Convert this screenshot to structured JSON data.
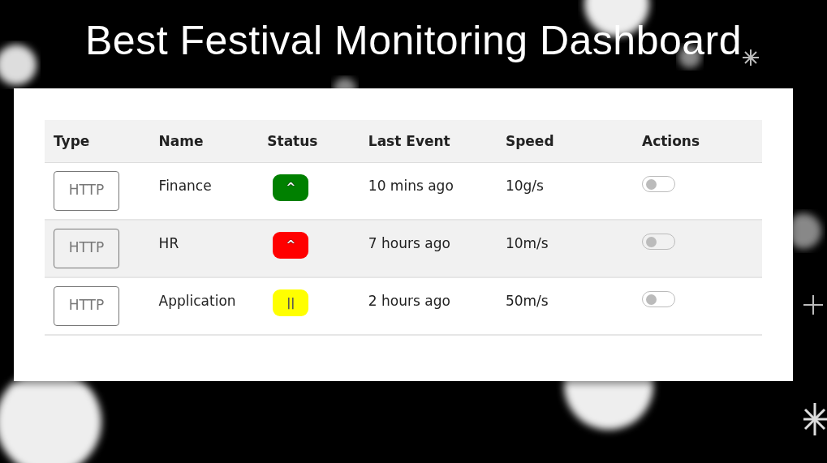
{
  "page": {
    "title": "Best Festival Monitoring Dashboard"
  },
  "table": {
    "columns": [
      "Type",
      "Name",
      "Status",
      "Last Event",
      "Speed",
      "Actions"
    ],
    "rows": [
      {
        "type": "HTTP",
        "name": "Finance",
        "status": "^",
        "color": "#008000",
        "last_event": "10 mins ago",
        "speed": "10g/s",
        "on": false,
        "highlighted": false
      },
      {
        "type": "HTTP",
        "name": "HR",
        "status": "^",
        "color": "#ff0000",
        "last_event": "7 hours ago",
        "speed": "10m/s",
        "on": false,
        "highlighted": true
      },
      {
        "type": "HTTP",
        "name": "Application",
        "status": "||",
        "color": "#ffff00",
        "last_event": "2 hours ago",
        "speed": "50m/s",
        "on": false,
        "highlighted": false
      }
    ]
  }
}
